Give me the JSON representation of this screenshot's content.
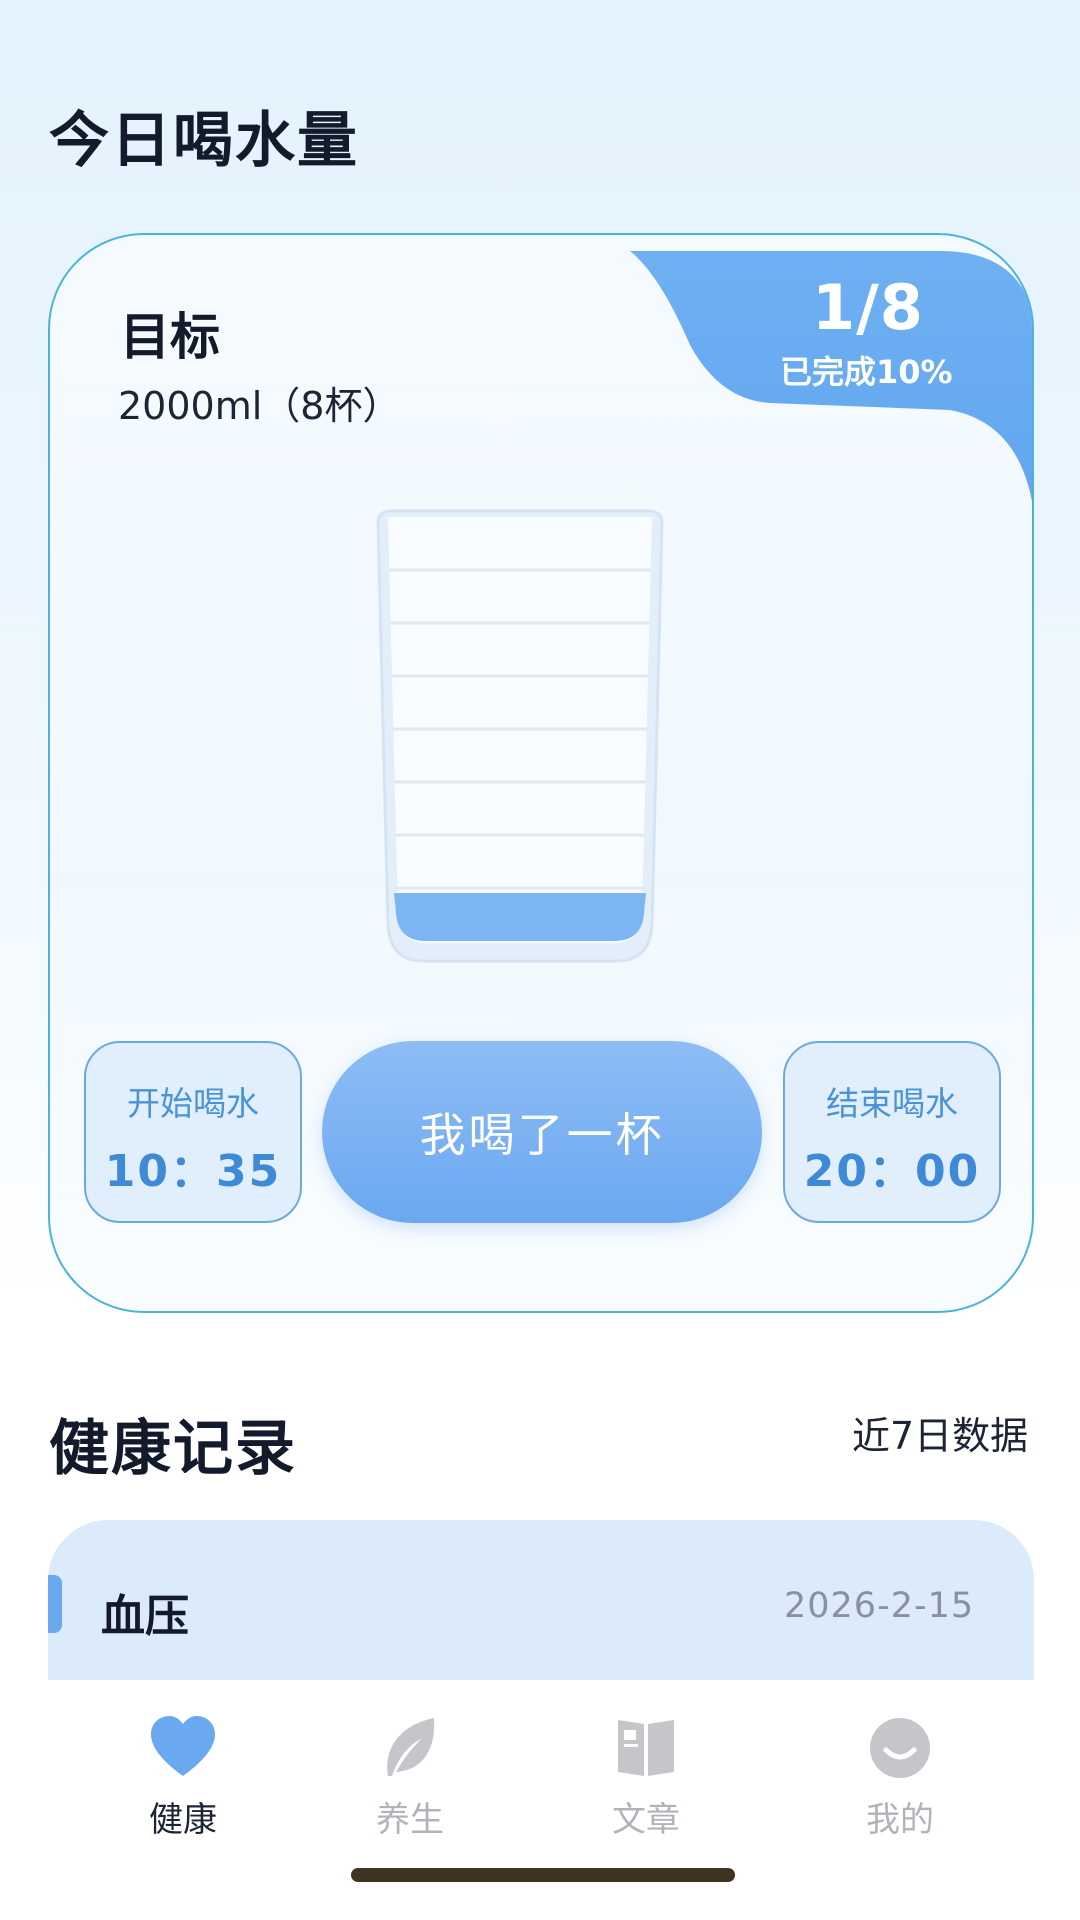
{
  "header": {
    "title": "今日喝水量"
  },
  "water_card": {
    "goal_label": "目标",
    "goal_value": "2000ml（8杯）",
    "progress_count": "1/8",
    "progress_percent": "已完成10%",
    "cups_total": 8,
    "cups_filled": 1,
    "start": {
      "label": "开始喝水",
      "time": "10：35"
    },
    "drink_button_label": "我喝了一杯",
    "end": {
      "label": "结束喝水",
      "time": "20：00"
    }
  },
  "records": {
    "title": "健康记录",
    "range": "近7日数据",
    "items": [
      {
        "name": "血压",
        "date": "2026-2-15"
      }
    ]
  },
  "nav": {
    "items": [
      {
        "label": "健康",
        "icon": "heart-icon",
        "active": true
      },
      {
        "label": "养生",
        "icon": "leaf-icon",
        "active": false
      },
      {
        "label": "文章",
        "icon": "book-icon",
        "active": false
      },
      {
        "label": "我的",
        "icon": "smile-icon",
        "active": false
      }
    ]
  },
  "colors": {
    "accent": "#6aa8f0",
    "card_border": "#4cb3d8",
    "time_text": "#3f8ad6",
    "inactive_nav": "#b0b4ba"
  }
}
